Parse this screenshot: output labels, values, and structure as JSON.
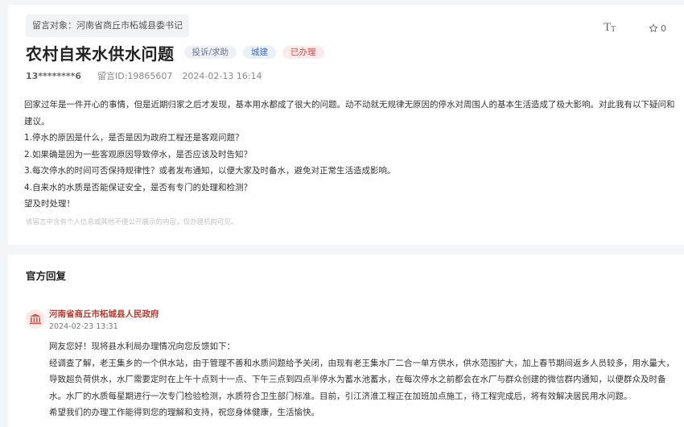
{
  "message": {
    "target": "留言对象：河南省商丘市柘城县委书记",
    "title": "农村自来水供水问题",
    "badges": [
      "投诉/求助",
      "城建",
      "已办理"
    ],
    "user": "13********6",
    "message_id": "留言ID:19865607",
    "datetime": "2024-02-13 16:14",
    "star_count": "0",
    "paragraphs": [
      "回家过年是一件开心的事情，但是近期归家之后才发现，基本用水都成了很大的问题。动不动就无规律无原因的停水对周围人的基本生活造成了极大影响。对此我有以下疑问和建议。",
      "1.停水的原因是什么，是否是因为政府工程还是客观问题？",
      "2.如果确是因为一些客观原因导致停水，是否应该及时告知？",
      "3.每次停水的时间可否保持规律性？或者发布通知，以便大家及时备水，避免对正常生活造成影响。",
      "4.自来水的水质是否能保证安全，是否有专门的处理和检测？",
      "望及时处理！"
    ],
    "privacy_note": "该留言中含有个人信息或其他不便公开展示的内容，仅办理机构可见。"
  },
  "reply": {
    "section_title": "官方回复",
    "org_name": "河南省商丘市柘城县人民政府",
    "datetime": "2024-02-23 13:31",
    "paragraphs": [
      "网友您好！现将县水利局办理情况向您反馈如下：",
      "经调查了解，老王集乡的一个供水站，由于管理不善和水质问题给予关闭，由现有老王集水厂二合一单方供水，供水范围扩大，加上春节期间返乡人员较多，用水量大，导致超负荷供水，水厂需要定时在上午十点到十一点、下午三点到四点半停水为蓄水池蓄水，在每次停水之前都会在水厂与群众创建的微信群内通知，以便群众及时备水。水厂的水质每星期进行一次专门检验检测，水质符合卫生部门标准。目前，引江济淮工程正在加班加点施工，待工程完成后，将有效解决居民用水问题。",
      "希望我们的办理工作能得到您的理解和支持，祝您身体健康，生活愉快。"
    ]
  },
  "icons": {
    "font_size": "font-size-icon",
    "star": "star-icon",
    "org": "government-building-icon"
  },
  "colors": {
    "org_name": "#c0392b",
    "badge_done": "#d94848",
    "badge_category": "#3d6fc2"
  }
}
